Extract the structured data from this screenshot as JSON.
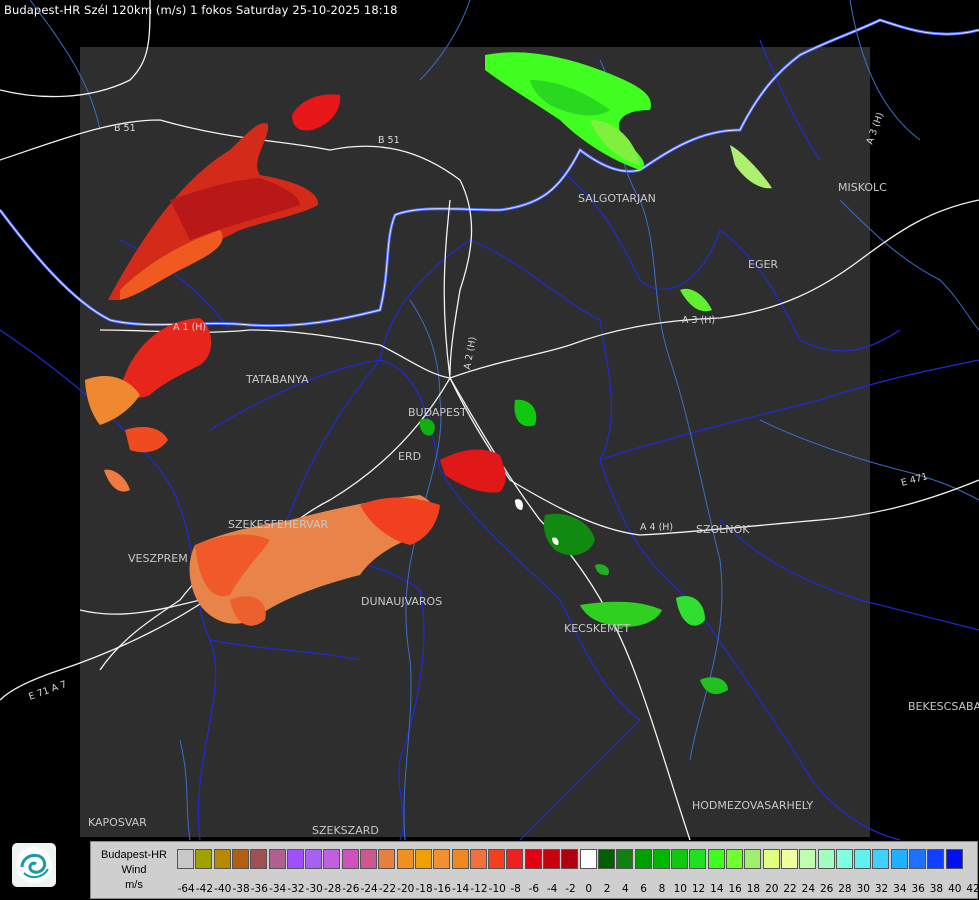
{
  "header": {
    "title": "Budapest-HR Szél 120km (m/s) 1 fokos Saturday 25-10-2025 18:18"
  },
  "map": {
    "cities": [
      {
        "key": "salgotarjan",
        "label": "SALGOTARJAN"
      },
      {
        "key": "miskolc",
        "label": "MISKOLC"
      },
      {
        "key": "eger",
        "label": "EGER"
      },
      {
        "key": "tatabanya",
        "label": "TATABANYA"
      },
      {
        "key": "budapest",
        "label": "BUDAPEST"
      },
      {
        "key": "erd",
        "label": "ERD"
      },
      {
        "key": "szekesfehervar",
        "label": "SZEKESFEHERVAR"
      },
      {
        "key": "veszprem",
        "label": "VESZPREM"
      },
      {
        "key": "dunaujvaros",
        "label": "DUNAUJVAROS"
      },
      {
        "key": "kecskemet",
        "label": "KECSKEMET"
      },
      {
        "key": "szolnok",
        "label": "SZOLNOK"
      },
      {
        "key": "bekescsaba",
        "label": "BEKESCSABA"
      },
      {
        "key": "hodmezovasarhely",
        "label": "HODMEZOVASARHELY"
      },
      {
        "key": "kaposvar",
        "label": "KAPOSVAR"
      },
      {
        "key": "szekszard",
        "label": "SZEKSZARD"
      }
    ],
    "roads": [
      {
        "key": "b51a",
        "label": "B 51"
      },
      {
        "key": "b51b",
        "label": "B 51"
      },
      {
        "key": "a2",
        "label": "A 2 (H)"
      },
      {
        "key": "a3",
        "label": "A 3 (H)"
      },
      {
        "key": "a3b",
        "label": "A 3 (H)"
      },
      {
        "key": "a1",
        "label": "A 1 (H)"
      },
      {
        "key": "a4",
        "label": "A 4 (H)"
      },
      {
        "key": "e471",
        "label": "E 471"
      },
      {
        "key": "e71",
        "label": "E 71 A 7"
      }
    ],
    "colors": {
      "background": "#000000",
      "radar_area": "#2e2e2e",
      "border": "#3a3aff",
      "roads": "#ffffff",
      "rivers": "#2f5fbf"
    }
  },
  "legend": {
    "label_lines": [
      "Budapest-HR",
      "Wind",
      "m/s"
    ],
    "ticks": [
      "-64",
      "-42",
      "-40",
      "-38",
      "-36",
      "-34",
      "-32",
      "-30",
      "-28",
      "-26",
      "-24",
      "-22",
      "-20",
      "-18",
      "-16",
      "-14",
      "-12",
      "-10",
      "-8",
      "-6",
      "-4",
      "-2",
      "0",
      "2",
      "4",
      "6",
      "8",
      "10",
      "12",
      "14",
      "16",
      "18",
      "20",
      "22",
      "24",
      "26",
      "28",
      "30",
      "32",
      "34",
      "36",
      "38",
      "40",
      "42"
    ],
    "colors": [
      "#c8c8c8",
      "#a0a000",
      "#b88800",
      "#b06010",
      "#a05050",
      "#b06090",
      "#9e50ff",
      "#a860f0",
      "#c060e0",
      "#d050c0",
      "#d05890",
      "#e88040",
      "#f09020",
      "#f0a000",
      "#f09030",
      "#f08820",
      "#f07040",
      "#f04020",
      "#f02020",
      "#e00010",
      "#c80010",
      "#b00010",
      "#ffffff",
      "#006000",
      "#108010",
      "#00a000",
      "#00b800",
      "#10c810",
      "#20e020",
      "#40ff20",
      "#70ff30",
      "#a0f070",
      "#e0ff80",
      "#f0ffa0",
      "#c0ffb0",
      "#a0ffc0",
      "#80ffe0",
      "#60f0f0",
      "#40d0ff",
      "#20b0ff",
      "#2070ff",
      "#1040ff",
      "#0010f0"
    ]
  },
  "logo": {
    "name": "omsz-logo"
  }
}
